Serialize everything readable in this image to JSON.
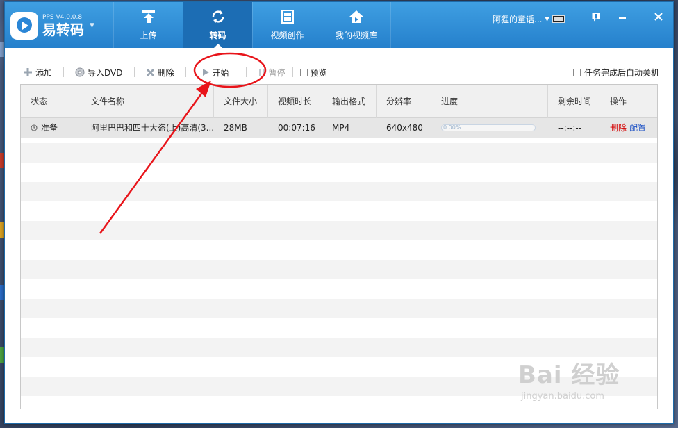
{
  "app": {
    "version": "V4.0.0.8",
    "brand_small": "PPS",
    "name": "易转码"
  },
  "nav": {
    "tabs": [
      {
        "label": "上传",
        "icon": "upload-icon"
      },
      {
        "label": "转码",
        "icon": "transcode-icon",
        "active": true
      },
      {
        "label": "视频创作",
        "icon": "film-icon"
      },
      {
        "label": "我的视频库",
        "icon": "home-library-icon"
      }
    ]
  },
  "user": {
    "name": "阿狸的童话..."
  },
  "toolbar": {
    "add": "添加",
    "import_dvd": "导入DVD",
    "delete": "删除",
    "start": "开始",
    "pause": "暂停",
    "preview": "预览",
    "auto_shutdown": "任务完成后自动关机"
  },
  "table": {
    "columns": [
      "状态",
      "文件名称",
      "文件大小",
      "视频时长",
      "输出格式",
      "分辨率",
      "进度",
      "剩余时间",
      "操作"
    ],
    "rows": [
      {
        "status": "准备",
        "filename": "阿里巴巴和四十大盗(上)高清(3...",
        "size": "28MB",
        "duration": "00:07:16",
        "format": "MP4",
        "resolution": "640x480",
        "progress_text": "0.00%",
        "progress": 0,
        "remaining": "--:--:--",
        "op_delete": "删除",
        "op_config": "配置"
      }
    ]
  },
  "watermark": {
    "main": "Bai 经验",
    "sub": "jingyan.baidu.com"
  },
  "colors": {
    "titlebar": "#2f8ad8",
    "active_tab": "#1c6db4",
    "annotation": "#e8141a",
    "delete_link": "#d40000",
    "config_link": "#1a4fc4"
  }
}
